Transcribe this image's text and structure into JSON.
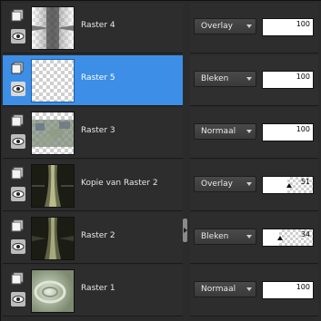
{
  "layers": [
    {
      "name": "Raster 4",
      "blend": "Overlay",
      "opacity": 100,
      "selected": false,
      "thumb": "raster4"
    },
    {
      "name": "Raster 5",
      "blend": "Bleken",
      "opacity": 100,
      "selected": true,
      "thumb": "raster5"
    },
    {
      "name": "Raster 3",
      "blend": "Normaal",
      "opacity": 100,
      "selected": false,
      "thumb": "raster3"
    },
    {
      "name": "Kopie van Raster 2",
      "blend": "Overlay",
      "opacity": 51,
      "selected": false,
      "thumb": "kopie"
    },
    {
      "name": "Raster 2",
      "blend": "Bleken",
      "opacity": 34,
      "selected": false,
      "thumb": "raster2"
    },
    {
      "name": "Raster 1",
      "blend": "Normaal",
      "opacity": 100,
      "selected": false,
      "thumb": "raster1"
    }
  ],
  "icons": {
    "layer": "layer-icon",
    "visibility": "eye-icon",
    "dropdown": "chevron-down-icon"
  },
  "colors": {
    "selected": "#3d8ee6",
    "panel": "#2b2b2b"
  }
}
